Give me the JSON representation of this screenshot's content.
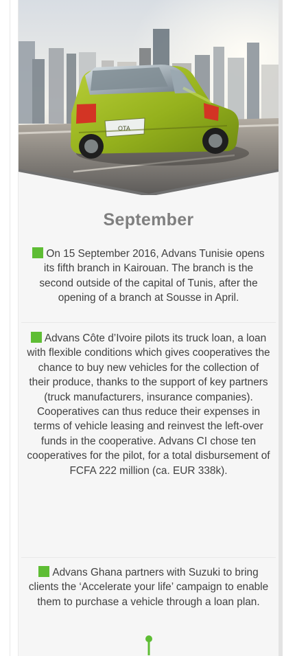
{
  "content": {
    "month": "September",
    "items": [
      {
        "text": "On 15 September 2016, Advans Tunisie opens its fifth branch in Kairouan. The branch is the second outside of the capital of Tunis, after the opening of a branch at Sousse in April."
      },
      {
        "text": "Advans Côte d’Ivoire pilots its truck loan, a loan with flexible conditions which gives cooperatives the chance to buy new vehicles for the collection of their produce, thanks to the support of key partners (truck manufacturers, insurance companies). Cooperatives can thus reduce their expenses in terms of vehicle leasing and reinvest the left-over funds in the cooperative. Advans CI chose ten cooperatives for the pilot, for a total disbursement of FCFA 222 million (ca. EUR 338k)."
      },
      {
        "text": "Advans Ghana partners with Suzuki to bring clients the ‘Accelerate your life’ campaign to enable them to purchase a vehicle through a loan plan."
      }
    ]
  },
  "colors": {
    "accent": "#5ebd34",
    "heading": "#7f7f7f",
    "body_text": "#3f3f3f",
    "card_bg": "#f6f6f6"
  },
  "icons": {
    "bullet": "green-square-icon",
    "pin": "timeline-pin-icon"
  }
}
